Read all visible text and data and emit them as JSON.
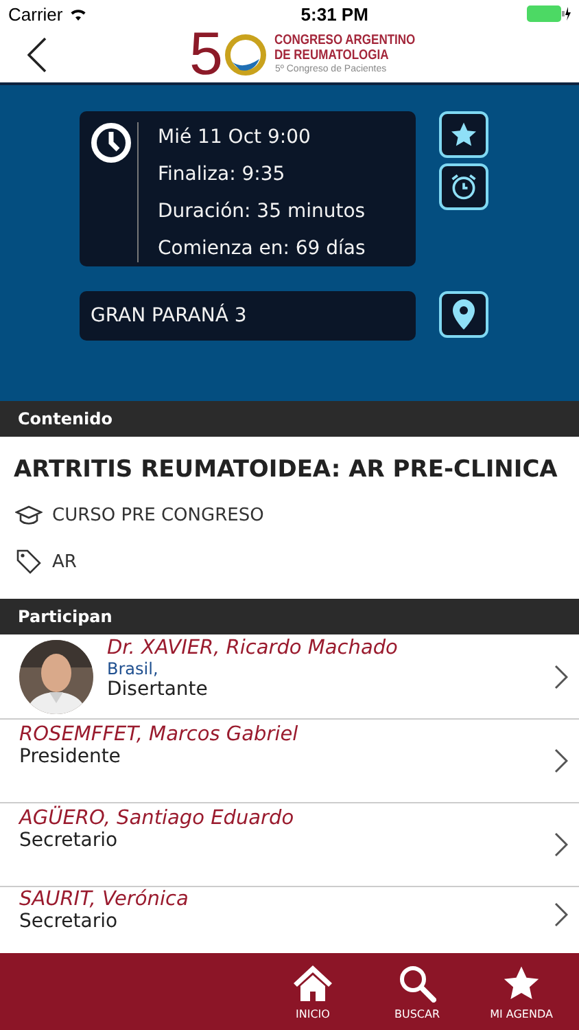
{
  "status_bar": {
    "carrier": "Carrier",
    "time": "5:31 PM"
  },
  "header": {
    "logo_number": "5",
    "logo_title_1": "CONGRESO ARGENTINO",
    "logo_title_2": "DE REUMATOLOGIA",
    "logo_subtitle": "5º Congreso de Pacientes"
  },
  "schedule": {
    "lines": [
      "Mié 11  Oct  9:00",
      "Finaliza: 9:35",
      "Duración: 35 minutos",
      "Comienza en: 69 días"
    ],
    "room": "GRAN PARANÁ 3"
  },
  "content": {
    "header": "Contenido",
    "title": "ARTRITIS REUMATOIDEA: AR PRE-CLINICA",
    "course": "CURSO PRE CONGRESO",
    "tag": "AR"
  },
  "participants": {
    "header": "Participan",
    "items": [
      {
        "name": "Dr. XAVIER, Ricardo Machado",
        "country": "Brasil,",
        "role": "Disertante"
      },
      {
        "name": "ROSEMFFET, Marcos Gabriel",
        "role": "Presidente",
        "kind": "plain"
      },
      {
        "name": "AGÜERO, Santiago Eduardo",
        "role": "Secretario",
        "kind": "plain"
      },
      {
        "name": "SAURIT, Verónica",
        "role": "Secretario",
        "kind": "plain"
      }
    ]
  },
  "tab_bar": [
    {
      "label": "INICIO",
      "kind": "home"
    },
    {
      "label": "BUSCAR",
      "kind": "search"
    },
    {
      "label": "MI AGENDA",
      "kind": "star"
    }
  ]
}
